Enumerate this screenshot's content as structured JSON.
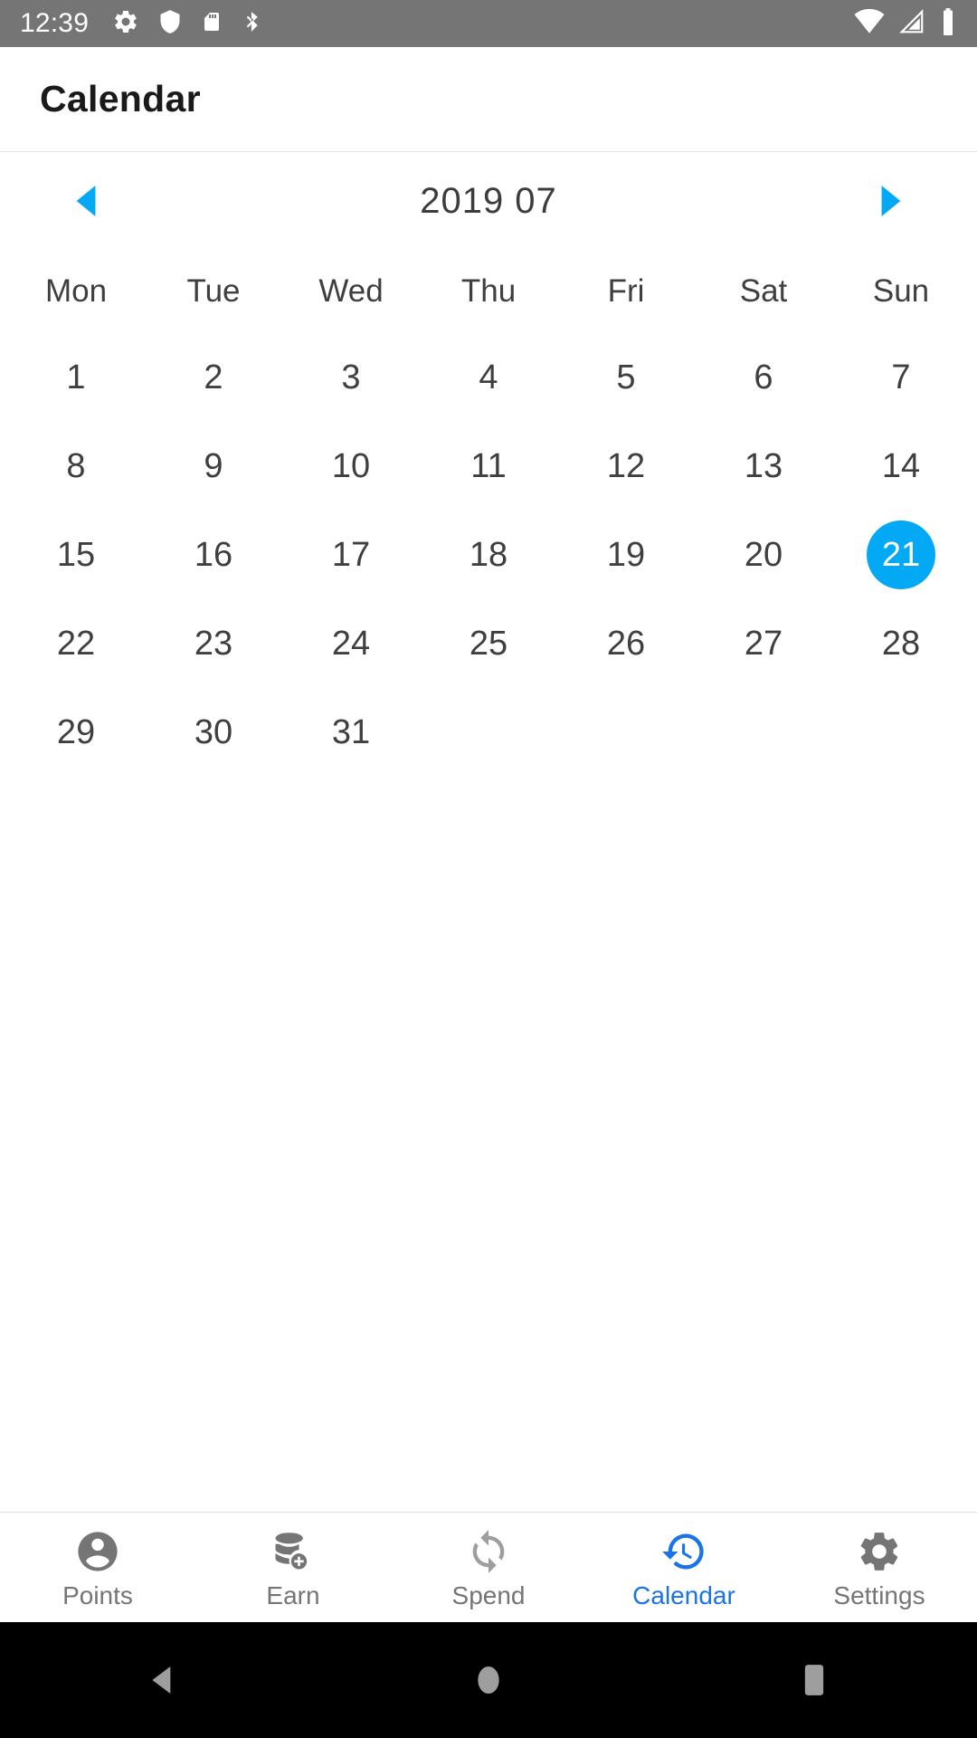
{
  "statusbar": {
    "time": "12:39",
    "left_icons": [
      "gear-icon",
      "shield-icon",
      "sdcard-icon",
      "bluetooth-disabled-icon"
    ],
    "right_icons": [
      "wifi-icon",
      "cellular-signal-icon",
      "battery-icon"
    ],
    "background": "#757575",
    "foreground": "#ffffff"
  },
  "appbar": {
    "title": "Calendar"
  },
  "month_nav": {
    "prev_label": "prev-month",
    "next_label": "next-month",
    "month_label": "2019 07",
    "year": "2019",
    "month": "07",
    "arrow_color": "#03a9f4"
  },
  "calendar": {
    "weekdays": [
      "Mon",
      "Tue",
      "Wed",
      "Thu",
      "Fri",
      "Sat",
      "Sun"
    ],
    "first_day_of_week": "Mon",
    "selected_day": "21",
    "selected_color": "#03a9f4",
    "selected_text_color": "#ffffff",
    "day_text_color": "#3f3f3f",
    "weeks": [
      [
        "1",
        "2",
        "3",
        "4",
        "5",
        "6",
        "7"
      ],
      [
        "8",
        "9",
        "10",
        "11",
        "12",
        "13",
        "14"
      ],
      [
        "15",
        "16",
        "17",
        "18",
        "19",
        "20",
        "21"
      ],
      [
        "22",
        "23",
        "24",
        "25",
        "26",
        "27",
        "28"
      ],
      [
        "29",
        "30",
        "31",
        "",
        "",
        "",
        ""
      ]
    ]
  },
  "tabbar": {
    "active_index": 3,
    "active_color": "#1a73e8",
    "inactive_color": "#757575",
    "tabs": [
      {
        "label": "Points",
        "icon": "account-circle-icon"
      },
      {
        "label": "Earn",
        "icon": "coins-add-icon"
      },
      {
        "label": "Spend",
        "icon": "sync-arrows-icon"
      },
      {
        "label": "Calendar",
        "icon": "history-clock-icon"
      },
      {
        "label": "Settings",
        "icon": "gear-icon"
      }
    ]
  },
  "sysnav": {
    "back": "back-button",
    "home": "home-button",
    "recents": "recents-button",
    "background": "#000000",
    "icon_color": "#9e9e9e"
  }
}
